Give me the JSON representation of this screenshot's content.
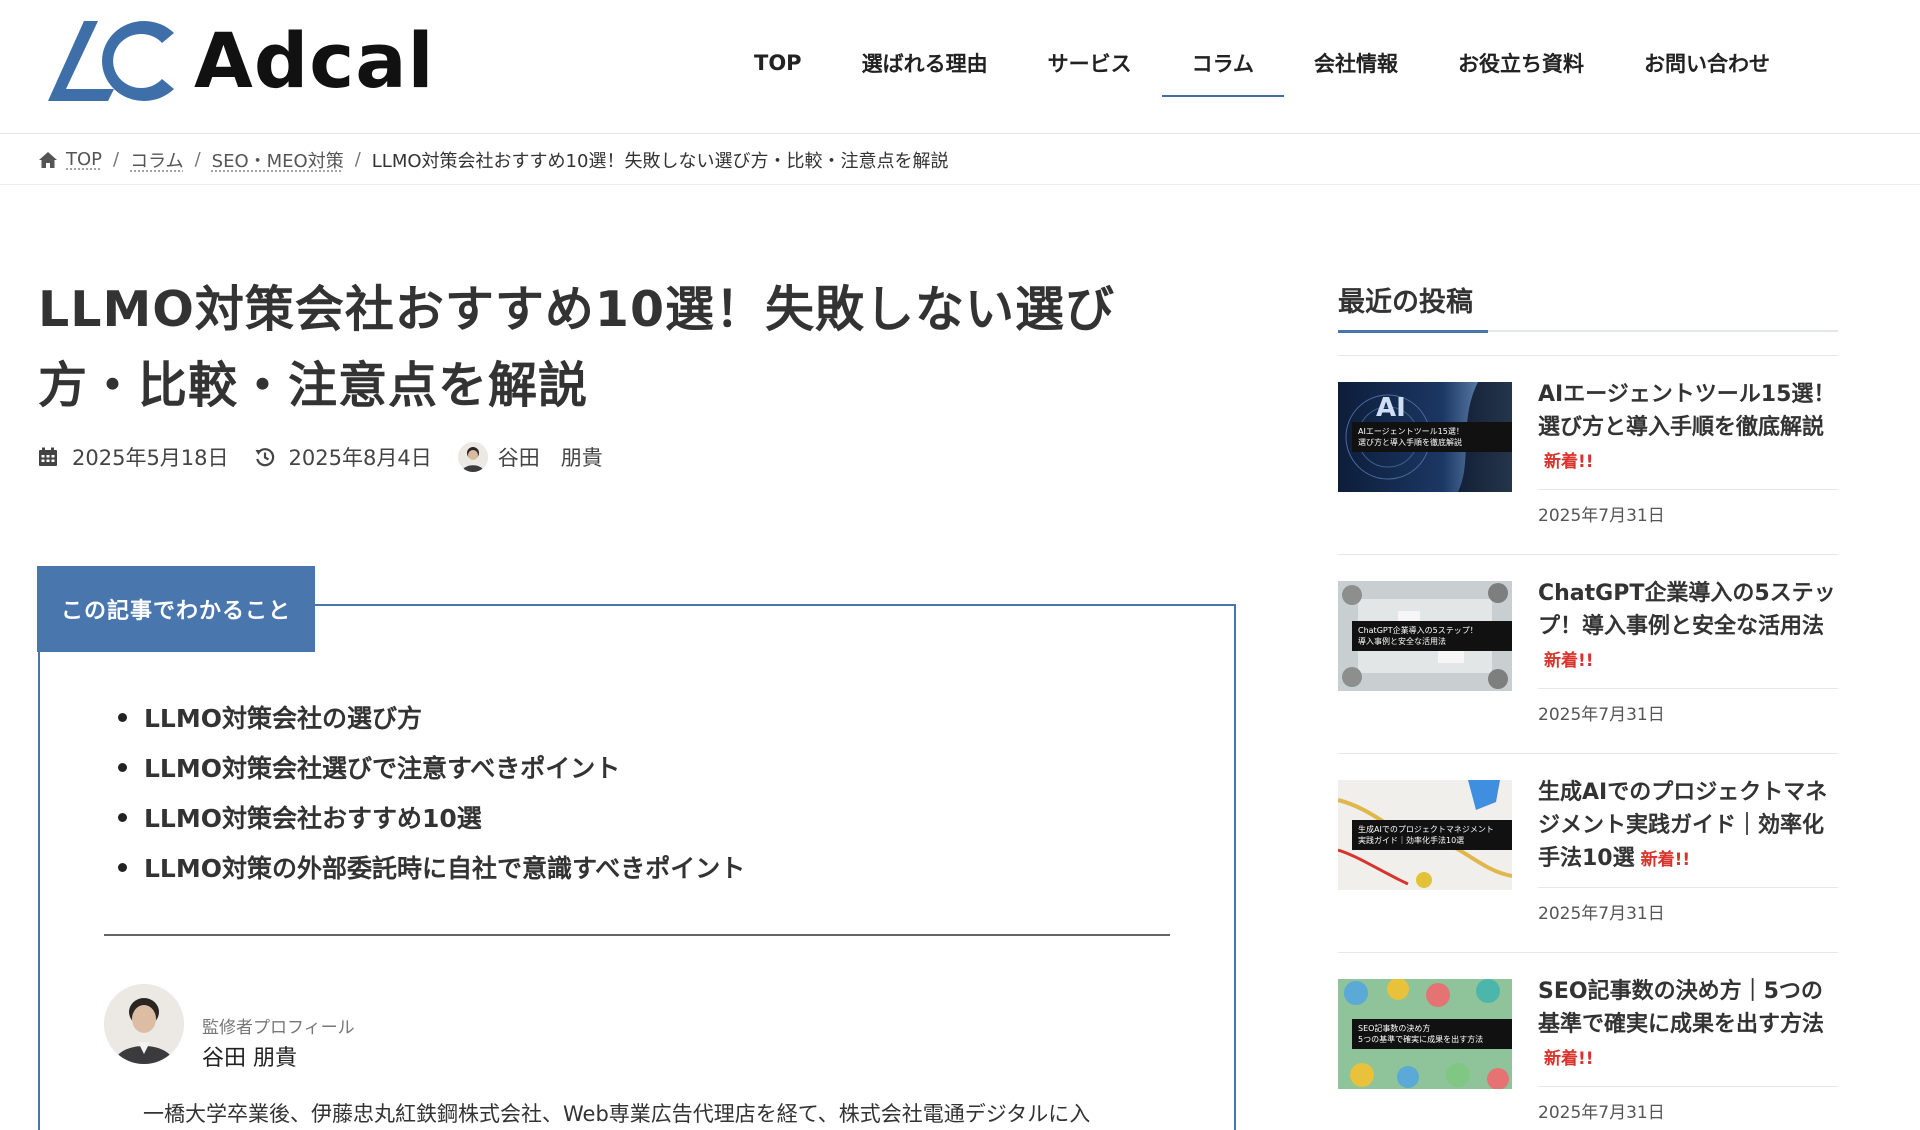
{
  "header": {
    "logo_text": "Adcal",
    "nav": [
      {
        "label": "TOP"
      },
      {
        "label": "選ばれる理由"
      },
      {
        "label": "サービス"
      },
      {
        "label": "コラム",
        "active": true
      },
      {
        "label": "会社情報"
      },
      {
        "label": "お役立ち資料"
      },
      {
        "label": "お問い合わせ"
      }
    ]
  },
  "breadcrumb": {
    "items": [
      "TOP",
      "コラム",
      "SEO・MEO対策"
    ],
    "current": "LLMO対策会社おすすめ10選！失敗しない選び方・比較・注意点を解説",
    "separator": "/"
  },
  "article": {
    "title_line1": "LLMO対策会社おすすめ10選！失敗しない選び",
    "title_line2": "方・比較・注意点を解説",
    "published": "2025年5月18日",
    "updated": "2025年8月4日",
    "author": "谷田　朋貴"
  },
  "toc": {
    "tab_label": "この記事でわかること",
    "items": [
      "LLMO対策会社の選び方",
      "LLMO対策会社選びで注意すべきポイント",
      "LLMO対策会社おすすめ10選",
      "LLMO対策の外部委託時に自社で意識すべきポイント"
    ]
  },
  "supervisor": {
    "label": "監修者プロフィール",
    "name": "谷田 朋貴",
    "bio": "一橋大学卒業後、伊藤忠丸紅鉄鋼株式会社、Web専業広告代理店を経て、株式会社電通デジタルに入"
  },
  "sidebar": {
    "heading": "最近の投稿",
    "new_label": "新着!!",
    "posts": [
      {
        "title": "AIエージェントツール15選！選び方と導入手順を徹底解説",
        "date": "2025年7月31日",
        "thumb_caption": "AIエージェントツール15選！\n選び方と導入手順を徹底解説"
      },
      {
        "title": "ChatGPT企業導入の5ステップ！導入事例と安全な活用法",
        "date": "2025年7月31日",
        "thumb_caption": "ChatGPT企業導入の5ステップ！\n導入事例と安全な活用法"
      },
      {
        "title": "生成AIでのプロジェクトマネジメント実践ガイド｜効率化手法10選",
        "date": "2025年7月31日",
        "thumb_caption": "生成AIでのプロジェクトマネジメント\n実践ガイド｜効率化手法10選"
      },
      {
        "title": "SEO記事数の決め方｜5つの基準で確実に成果を出す方法",
        "date": "2025年7月31日",
        "thumb_caption": "SEO記事数の決め方\n5つの基準で確実に成果を出す方法"
      }
    ]
  },
  "colors": {
    "accent": "#4a76ae",
    "logo_blue": "#3f6fa9",
    "new_badge": "#d9342b",
    "text": "#333333"
  },
  "icons": {
    "breadcrumb_home": "home-icon",
    "published": "calendar-icon",
    "updated": "history-icon"
  }
}
